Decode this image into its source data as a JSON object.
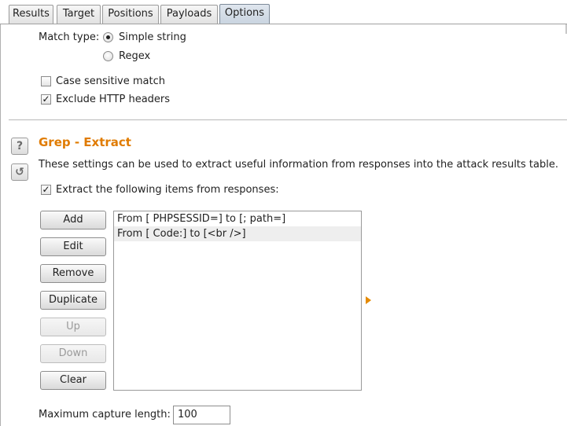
{
  "tabs": [
    {
      "label": "Results",
      "active": false
    },
    {
      "label": "Target",
      "active": false
    },
    {
      "label": "Positions",
      "active": false
    },
    {
      "label": "Payloads",
      "active": false
    },
    {
      "label": "Options",
      "active": true
    }
  ],
  "match_type": {
    "label": "Match type:",
    "options": [
      {
        "label": "Simple string",
        "selected": true
      },
      {
        "label": "Regex",
        "selected": false
      }
    ]
  },
  "checkboxes": {
    "case_sensitive": {
      "label": "Case sensitive match",
      "checked": false
    },
    "exclude_headers": {
      "label": "Exclude HTTP headers",
      "checked": true
    }
  },
  "grep_extract": {
    "title": "Grep - Extract",
    "description": "These settings can be used to extract useful information from responses into the attack results table.",
    "extract_checkbox": {
      "label": "Extract the following items from responses:",
      "checked": true
    },
    "help_icon": "?",
    "reset_icon": "↺",
    "buttons": {
      "add": "Add",
      "edit": "Edit",
      "remove": "Remove",
      "duplicate": "Duplicate",
      "up": "Up",
      "down": "Down",
      "clear": "Clear"
    },
    "items": [
      "From [ PHPSESSID=] to [; path=]",
      "From [ Code:] to [<br />]"
    ],
    "max_capture": {
      "label": "Maximum capture length:",
      "value": "100"
    }
  },
  "colors": {
    "accent_title": "#e07b00",
    "selected_row": "#eeeeee"
  }
}
